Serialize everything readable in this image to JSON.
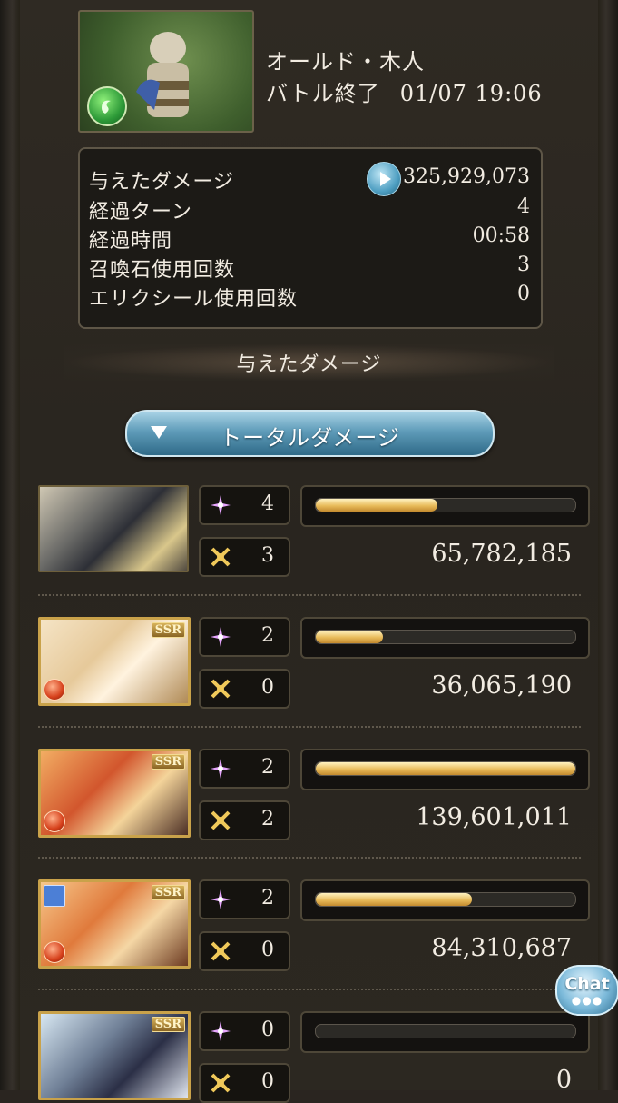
{
  "boss": {
    "name": "オールド・木人",
    "status": "バトル終了",
    "datetime": "01/07 19:06"
  },
  "stats": [
    {
      "label": "与えたダメージ",
      "value": "325,929,073"
    },
    {
      "label": "経過ターン",
      "value": "4"
    },
    {
      "label": "経過時間",
      "value": "00:58"
    },
    {
      "label": "召喚石使用回数",
      "value": "3"
    },
    {
      "label": "エリクシール使用回数",
      "value": "0"
    }
  ],
  "section_title": "与えたダメージ",
  "dropdown": {
    "label": "トータルダメージ"
  },
  "rows": [
    {
      "skills": "4",
      "ougi": "3",
      "damage": "65,782,185",
      "bar_fraction": 0.47
    },
    {
      "skills": "2",
      "ougi": "0",
      "damage": "36,065,190",
      "bar_fraction": 0.26
    },
    {
      "skills": "2",
      "ougi": "2",
      "damage": "139,601,011",
      "bar_fraction": 1.0
    },
    {
      "skills": "2",
      "ougi": "0",
      "damage": "84,310,687",
      "bar_fraction": 0.6
    },
    {
      "skills": "0",
      "ougi": "0",
      "damage": "0",
      "bar_fraction": 0.0
    }
  ],
  "badges": {
    "ssr": "SSR"
  },
  "chat": {
    "label": "Chat",
    "dots": "●●●"
  },
  "colors": {
    "accent_bar": "#e8bb5a",
    "panel": "#2a2520",
    "button_blue": "#5f9cb9"
  },
  "icons": {
    "skill": "sparkle-icon",
    "ougi": "swords-icon",
    "element": "fire-element-icon",
    "boss_element": "wind-element-icon",
    "ring": "ring-icon"
  }
}
